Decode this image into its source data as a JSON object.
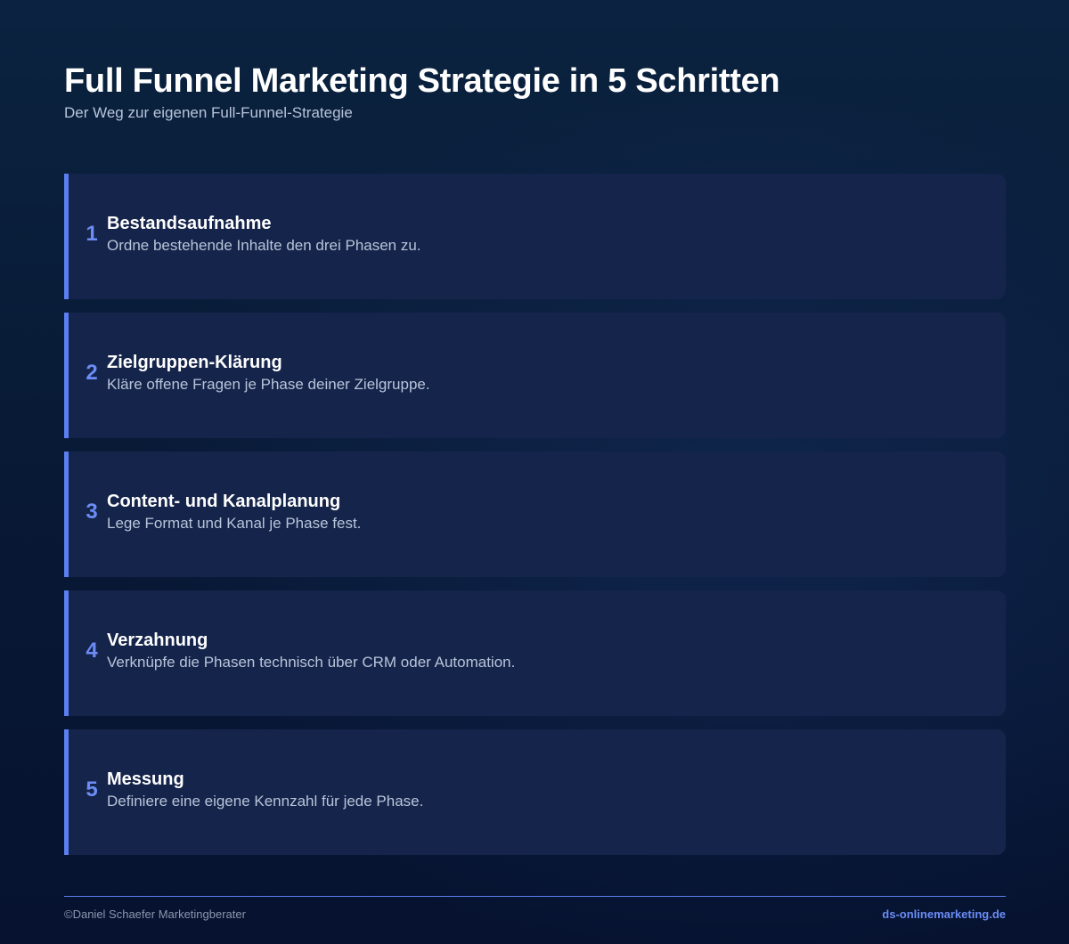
{
  "header": {
    "title": "Full Funnel Marketing Strategie in 5 Schritten",
    "subtitle": "Der Weg zur eigenen Full-Funnel-Strategie"
  },
  "steps": [
    {
      "number": "1",
      "title": "Bestandsaufnahme",
      "description": "Ordne bestehende Inhalte den drei Phasen zu."
    },
    {
      "number": "2",
      "title": "Zielgruppen-Klärung",
      "description": "Kläre offene Fragen je Phase deiner Zielgruppe."
    },
    {
      "number": "3",
      "title": "Content- und Kanalplanung",
      "description": "Lege Format und Kanal je Phase fest."
    },
    {
      "number": "4",
      "title": "Verzahnung",
      "description": "Verknüpfe die Phasen technisch über CRM oder Automation."
    },
    {
      "number": "5",
      "title": "Messung",
      "description": "Definiere eine eigene Kennzahl für jede Phase."
    }
  ],
  "footer": {
    "copyright": "©Daniel Schaefer Marketingberater",
    "website": "ds-onlinemarketing.de"
  },
  "colors": {
    "accent": "#5b7ff0",
    "card_background": "#15244a",
    "page_background": "#081a36"
  }
}
